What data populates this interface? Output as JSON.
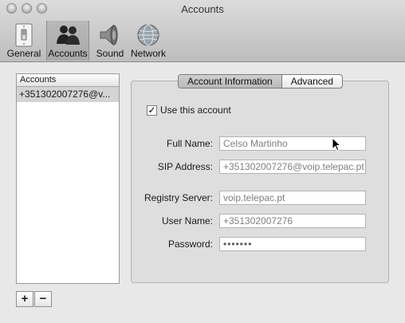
{
  "window": {
    "title": "Accounts"
  },
  "toolbar": {
    "items": [
      {
        "label": "General",
        "icon": "light-switch-icon"
      },
      {
        "label": "Accounts",
        "icon": "people-icon"
      },
      {
        "label": "Sound",
        "icon": "speaker-icon"
      },
      {
        "label": "Network",
        "icon": "globe-icon"
      }
    ],
    "selected": "Accounts"
  },
  "accounts": {
    "header": "Accounts",
    "items": [
      "+351302007276@v..."
    ],
    "selected_index": 0,
    "add_label": "+",
    "remove_label": "−"
  },
  "tabs": [
    {
      "label": "Account Information",
      "active": true
    },
    {
      "label": "Advanced",
      "active": false
    }
  ],
  "form": {
    "use_account": {
      "label": "Use this account",
      "checked": true,
      "mark": "✓"
    },
    "full_name": {
      "label": "Full Name:",
      "value": "Celso Martinho"
    },
    "sip_address": {
      "label": "SIP Address:",
      "value": "+351302007276@voip.telepac.pt"
    },
    "registry_server": {
      "label": "Registry Server:",
      "value": "voip.telepac.pt"
    },
    "user_name": {
      "label": "User Name:",
      "value": "+351302007276"
    },
    "password": {
      "label": "Password:",
      "value": "•••••••"
    }
  }
}
